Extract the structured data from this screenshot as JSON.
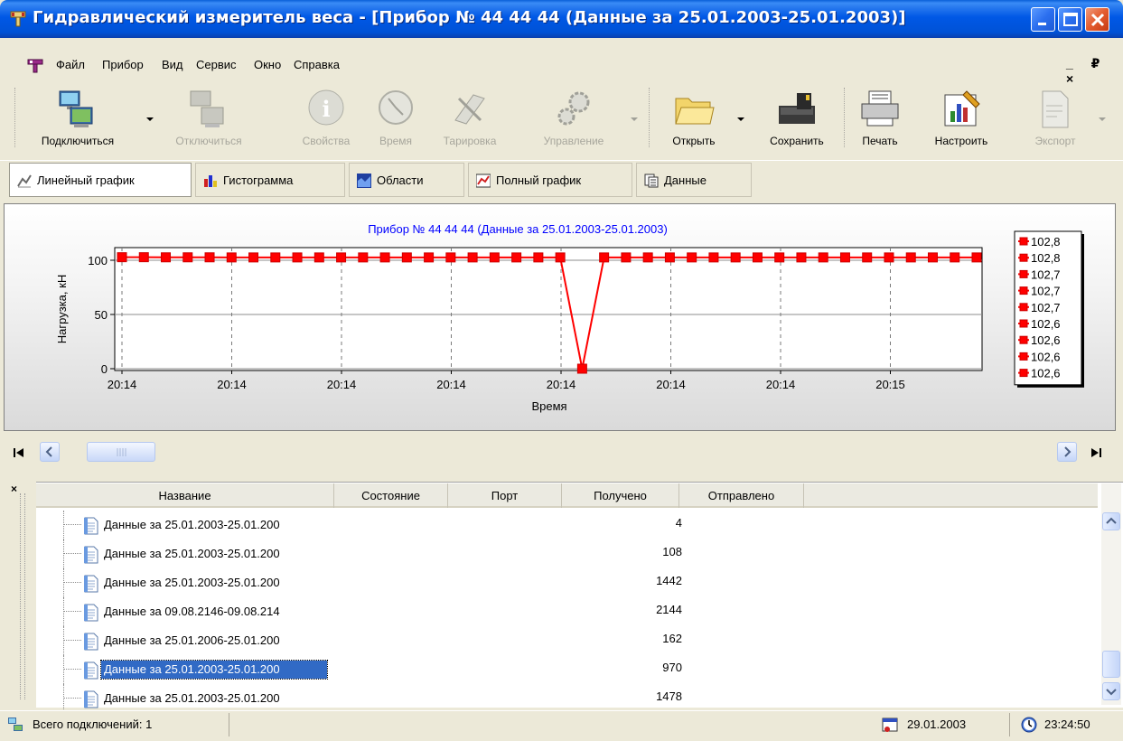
{
  "window": {
    "title": "Гидравлический измеритель веса - [Прибор № 44 44 44 (Данные за 25.01.2003-25.01.2003)]"
  },
  "menu": {
    "items": [
      "Файл",
      "Прибор",
      "Вид",
      "Сервис",
      "Окно",
      "Справка"
    ],
    "mdi_controls": "_ ₽ ×"
  },
  "toolbar": {
    "connect": "Подключиться",
    "disconnect": "Отключиться",
    "properties": "Свойства",
    "time": "Время",
    "calibration": "Тарировка",
    "control": "Управление",
    "open": "Открыть",
    "save": "Сохранить",
    "print": "Печать",
    "configure": "Настроить",
    "export": "Экспорт"
  },
  "tabs": [
    {
      "label": "Линейный график",
      "active": true
    },
    {
      "label": "Гистограмма",
      "active": false
    },
    {
      "label": "Области",
      "active": false
    },
    {
      "label": "Полный график",
      "active": false
    },
    {
      "label": "Данные",
      "active": false
    }
  ],
  "chart_data": {
    "type": "line",
    "title": "Прибор № 44 44 44 (Данные за 25.01.2003-25.01.2003)",
    "xlabel": "Время",
    "ylabel": "Нагрузка, кН",
    "ylim": [
      0,
      100
    ],
    "yticks": [
      0,
      50,
      100
    ],
    "xtick_labels": [
      "20:14",
      "20:14",
      "20:14",
      "20:14",
      "20:14",
      "20:14",
      "20:14",
      "20:15"
    ],
    "series": [
      {
        "color": "#FF0000",
        "marker_color": "#CC0000",
        "values": [
          102.8,
          102.8,
          102.7,
          102.7,
          102.7,
          102.6,
          102.6,
          102.6,
          102.6,
          102.6,
          102.6,
          102.6,
          102.6,
          102.6,
          102.6,
          102.6,
          102.6,
          102.6,
          102.6,
          102.6,
          102.6,
          0,
          102.6,
          102.6,
          102.6,
          102.6,
          102.6,
          102.6,
          102.6,
          102.6,
          102.6,
          102.6,
          102.6,
          102.6,
          102.6,
          102.6,
          102.6,
          102.6,
          102.6,
          102.6
        ]
      }
    ],
    "legend": {
      "placement": "right",
      "entries": [
        "102,8",
        "102,8",
        "102,7",
        "102,7",
        "102,7",
        "102,6",
        "102,6",
        "102,6",
        "102,6"
      ]
    },
    "grid": true
  },
  "list": {
    "columns": [
      "Название",
      "Состояние",
      "Порт",
      "Получено",
      "Отправлено"
    ],
    "rows": [
      {
        "name": "Данные за 25.01.2003-25.01.200",
        "received": "4",
        "selected": false
      },
      {
        "name": "Данные за 25.01.2003-25.01.200",
        "received": "108",
        "selected": false
      },
      {
        "name": "Данные за 25.01.2003-25.01.200",
        "received": "1442",
        "selected": false
      },
      {
        "name": "Данные за 09.08.2146-09.08.214",
        "received": "2144",
        "selected": false
      },
      {
        "name": "Данные за 25.01.2006-25.01.200",
        "received": "162",
        "selected": false
      },
      {
        "name": "Данные за 25.01.2003-25.01.200",
        "received": "970",
        "selected": true
      },
      {
        "name": "Данные за 25.01.2003-25.01.200",
        "received": "1478",
        "selected": false
      }
    ]
  },
  "status": {
    "connections": "Всего подключений: 1",
    "date": "29.01.2003",
    "time": "23:24:50"
  },
  "colors": {
    "title_bar": "#0058E6",
    "selection": "#316AC5",
    "chart_title": "#0000FF",
    "series": "#FF0000"
  }
}
